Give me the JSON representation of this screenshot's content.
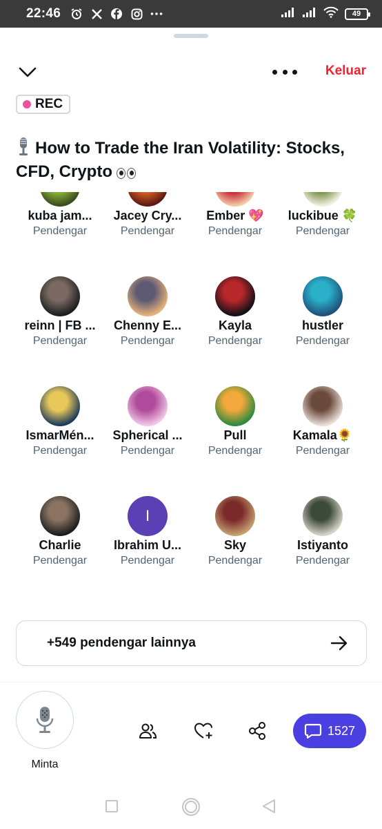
{
  "status_bar": {
    "time": "22:46",
    "battery": "49"
  },
  "header": {
    "leave_label": "Keluar"
  },
  "rec_badge": "REC",
  "space": {
    "title": "How to Trade the Iran Volatility: Stocks, CFD, Crypto"
  },
  "listeners": [
    {
      "name": "kuba jam...",
      "role": "Pendengar",
      "colors": [
        "#3b4a1f",
        "#8fbf3a"
      ]
    },
    {
      "name": "Jacey Cry...",
      "role": "Pendengar",
      "colors": [
        "#5a1a10",
        "#e2642a"
      ]
    },
    {
      "name": "Ember 💖",
      "role": "Pendengar",
      "colors": [
        "#f3c9a6",
        "#c2172a"
      ]
    },
    {
      "name": "luckibue 🍀",
      "role": "Pendengar",
      "colors": [
        "#f2ede3",
        "#6b8a3a"
      ]
    },
    {
      "name": "reinn | FB ...",
      "role": "Pendengar",
      "colors": [
        "#1d1d1d",
        "#7a6a63"
      ]
    },
    {
      "name": "Chenny E...",
      "role": "Pendengar",
      "colors": [
        "#e8b37a",
        "#5e5a73"
      ]
    },
    {
      "name": "Kayla",
      "role": "Pendengar",
      "colors": [
        "#101018",
        "#b8282a"
      ]
    },
    {
      "name": "hustler",
      "role": "Pendengar",
      "colors": [
        "#1f4f7a",
        "#2ab0c8"
      ]
    },
    {
      "name": "IsmarMén...",
      "role": "Pendengar",
      "colors": [
        "#1a3a5a",
        "#e9c85a"
      ]
    },
    {
      "name": "Spherical ...",
      "role": "Pendengar",
      "colors": [
        "#f0c8e6",
        "#b04a9a"
      ]
    },
    {
      "name": "Pull",
      "role": "Pendengar",
      "colors": [
        "#2b8a3e",
        "#f2a83a"
      ]
    },
    {
      "name": "Kamala🌻",
      "role": "Pendengar",
      "colors": [
        "#e9ddd5",
        "#6a4a3c"
      ]
    },
    {
      "name": "Charlie",
      "role": "Pendengar",
      "colors": [
        "#1c1c1e",
        "#8a7360"
      ]
    },
    {
      "name": "Ibrahim U...",
      "role": "Pendengar",
      "colors": [
        "#5b3fb5",
        "#5b3fb5"
      ],
      "initial": "I"
    },
    {
      "name": "Sky",
      "role": "Pendengar",
      "colors": [
        "#c6a070",
        "#7a2a2a"
      ]
    },
    {
      "name": "Istiyanto",
      "role": "Pendengar",
      "colors": [
        "#d8d3c8",
        "#3c4a3a"
      ]
    }
  ],
  "more_listeners_label": "+549 pendengar lainnya",
  "bottom_bar": {
    "request_label": "Minta",
    "chat_count": "1527"
  }
}
